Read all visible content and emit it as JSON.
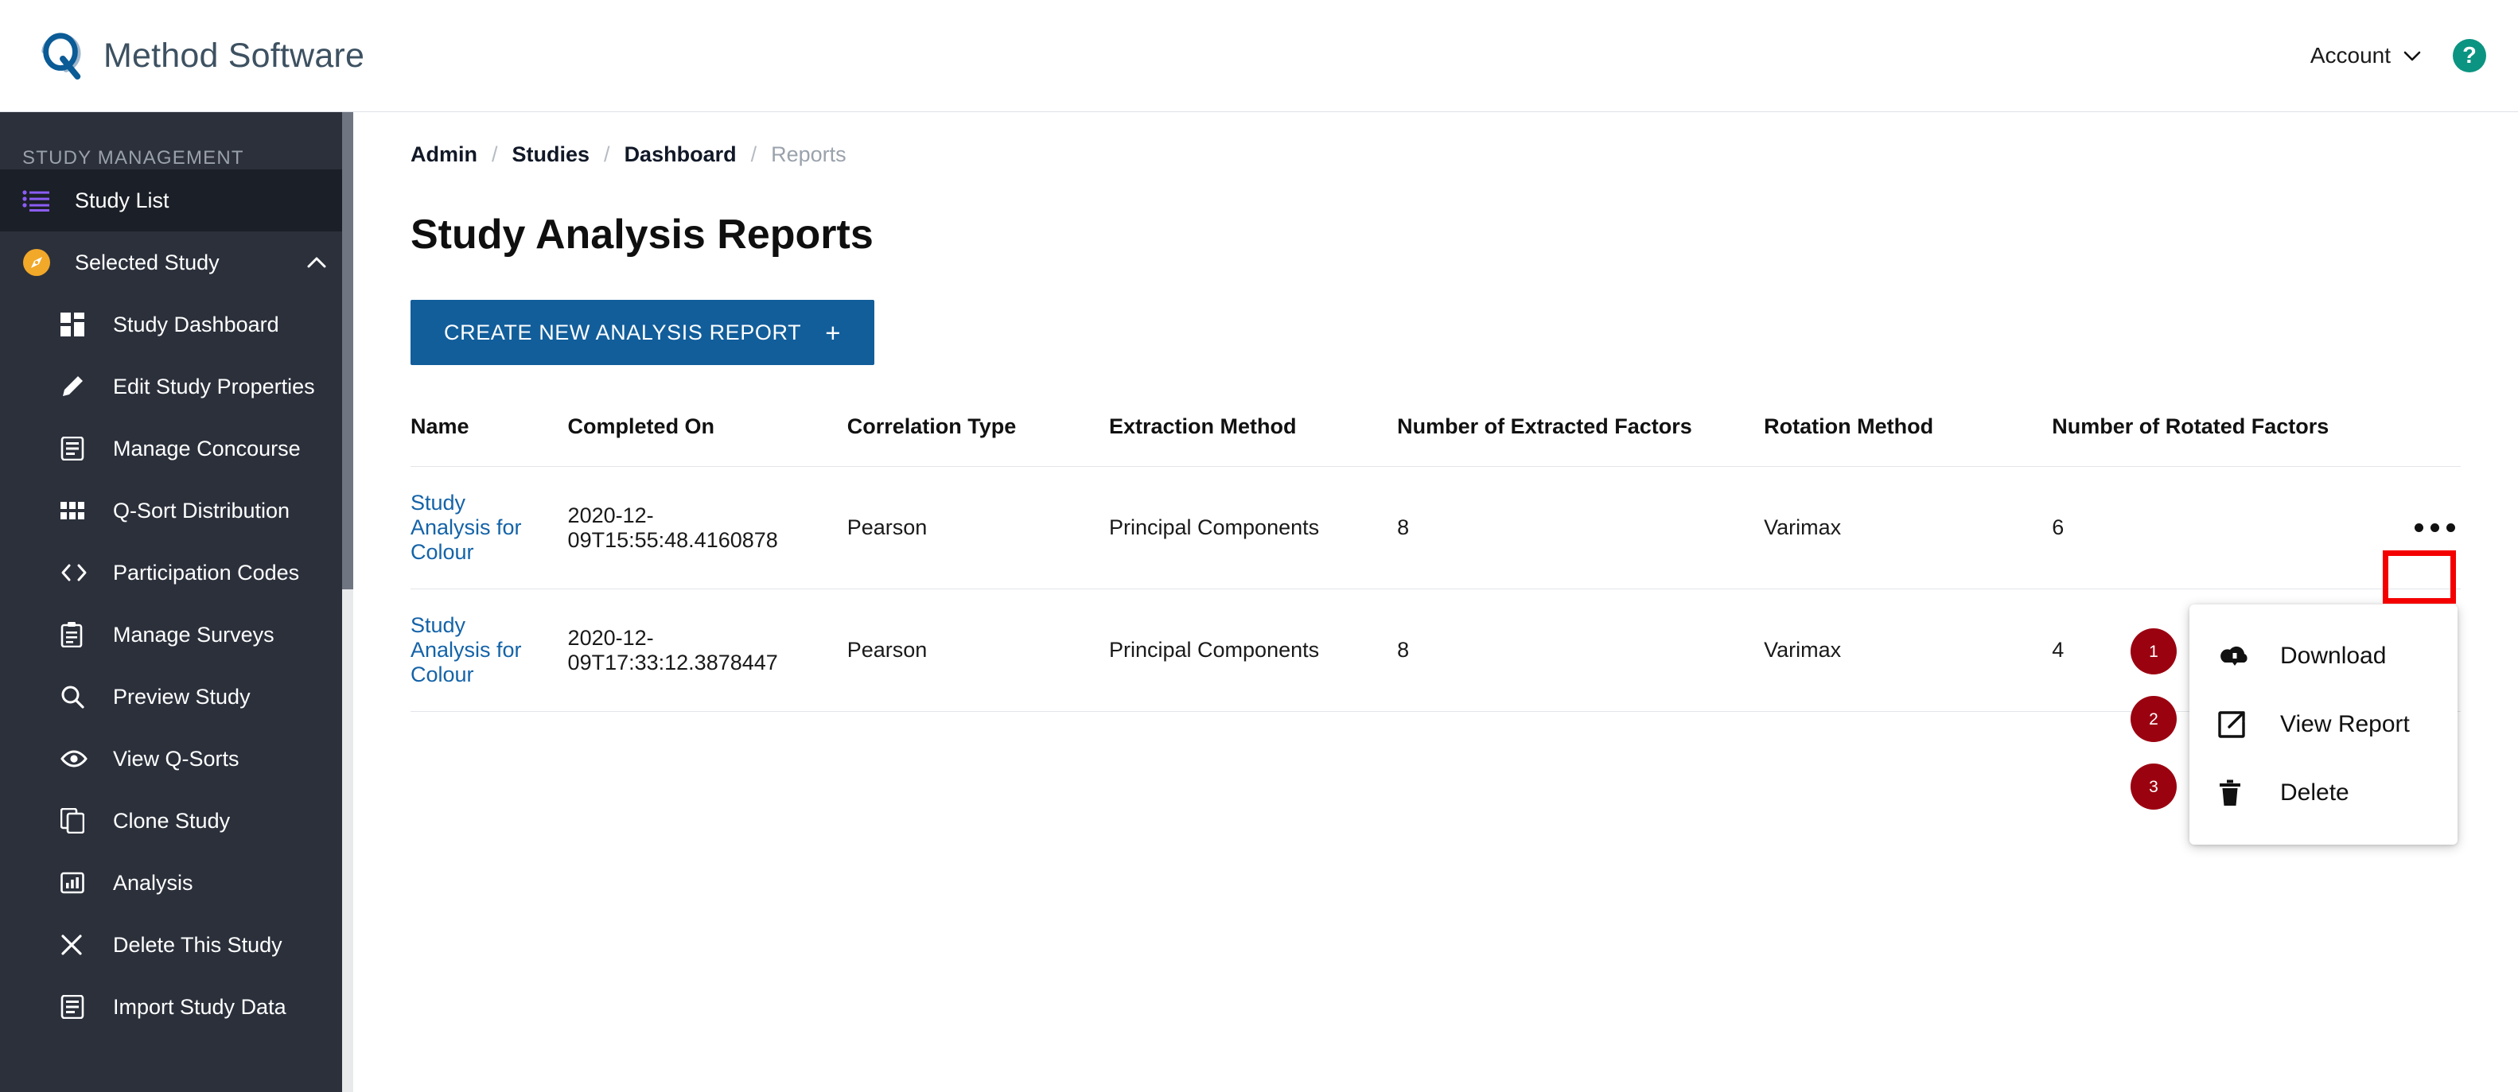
{
  "header": {
    "brand_name": "Method Software",
    "logo_icon": "q-logo-icon",
    "account_label": "Account",
    "account_chevron_icon": "chevron-down-icon",
    "help_label": "?",
    "help_icon": "help-circle-icon"
  },
  "sidebar": {
    "section_title": "STUDY MANAGEMENT",
    "items": [
      {
        "label": "Study List",
        "icon": "list-icon",
        "level": 0,
        "active": true
      },
      {
        "label": "Selected Study",
        "icon": "compass-icon",
        "level": 0,
        "active": false,
        "chevron": "chevron-up-icon"
      },
      {
        "label": "Study Dashboard",
        "icon": "dashboard-icon",
        "level": 1,
        "active": false
      },
      {
        "label": "Edit Study Properties",
        "icon": "pencil-icon",
        "level": 1,
        "active": false
      },
      {
        "label": "Manage Concourse",
        "icon": "document-icon",
        "level": 1,
        "active": false
      },
      {
        "label": "Q-Sort Distribution",
        "icon": "grid-icon",
        "level": 1,
        "active": false
      },
      {
        "label": "Participation Codes",
        "icon": "code-icon",
        "level": 1,
        "active": false
      },
      {
        "label": "Manage Surveys",
        "icon": "clipboard-icon",
        "level": 1,
        "active": false
      },
      {
        "label": "Preview Study",
        "icon": "search-icon",
        "level": 1,
        "active": false
      },
      {
        "label": "View Q-Sorts",
        "icon": "eye-icon",
        "level": 1,
        "active": false
      },
      {
        "label": "Clone Study",
        "icon": "copy-icon",
        "level": 1,
        "active": false
      },
      {
        "label": "Analysis",
        "icon": "chart-icon",
        "level": 1,
        "active": false
      },
      {
        "label": "Delete This Study",
        "icon": "close-icon",
        "level": 1,
        "active": false
      },
      {
        "label": "Import Study Data",
        "icon": "document-icon",
        "level": 1,
        "active": false
      }
    ]
  },
  "breadcrumb": {
    "items": [
      "Admin",
      "Studies",
      "Dashboard"
    ],
    "separator": "/",
    "current": "Reports"
  },
  "main": {
    "page_title": "Study Analysis Reports",
    "create_button_label": "CREATE NEW ANALYSIS REPORT",
    "create_button_plus": "+",
    "table": {
      "columns": [
        "Name",
        "Completed On",
        "Correlation Type",
        "Extraction Method",
        "Number of Extracted Factors",
        "Rotation Method",
        "Number of Rotated Factors"
      ],
      "rows": [
        {
          "name": "Study Analysis for Colour",
          "completed_on": "2020-12-09T15:55:48.4160878",
          "correlation_type": "Pearson",
          "extraction_method": "Principal Components",
          "extracted_factors": "8",
          "rotation_method": "Varimax",
          "rotated_factors": "6",
          "actions_icon": "ellipsis-icon"
        },
        {
          "name": "Study Analysis for Colour",
          "completed_on": "2020-12-09T17:33:12.3878447",
          "correlation_type": "Pearson",
          "extraction_method": "Principal Components",
          "extracted_factors": "8",
          "rotation_method": "Varimax",
          "rotated_factors": "4",
          "actions_icon": "ellipsis-icon"
        }
      ]
    }
  },
  "context_menu": {
    "items": [
      {
        "label": "Download",
        "icon": "cloud-download-icon",
        "badge": "1"
      },
      {
        "label": "View Report",
        "icon": "external-link-icon",
        "badge": "2"
      },
      {
        "label": "Delete",
        "icon": "trash-icon",
        "badge": "3"
      }
    ]
  },
  "annotations": {
    "highlight_color": "#f40000",
    "badge_color": "#9b0210",
    "accent_color": "#125e9b",
    "link_color": "#1463a8",
    "sidebar_color": "#2b303b",
    "help_color": "#0b9481"
  }
}
